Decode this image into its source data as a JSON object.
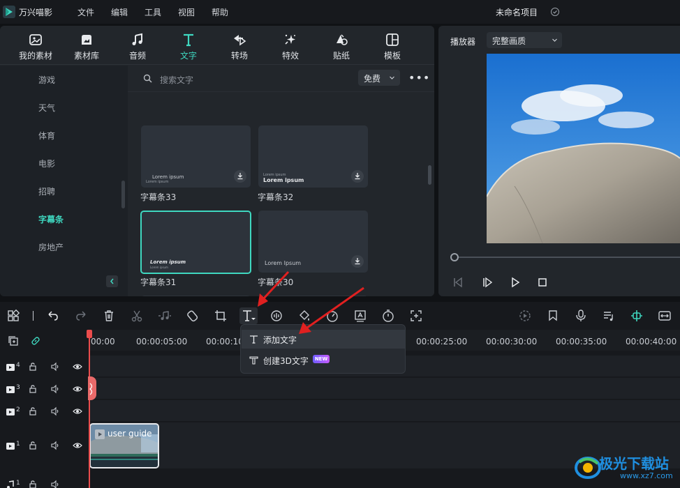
{
  "app": {
    "name": "万兴喵影",
    "project_name": "未命名项目"
  },
  "menu": [
    "文件",
    "编辑",
    "工具",
    "视图",
    "帮助"
  ],
  "tabs": [
    {
      "label": "我的素材",
      "icon": "my-media-icon"
    },
    {
      "label": "素材库",
      "icon": "stock-library-icon"
    },
    {
      "label": "音频",
      "icon": "music-note-icon"
    },
    {
      "label": "文字",
      "icon": "text-t-icon",
      "active": true
    },
    {
      "label": "转场",
      "icon": "transition-icon"
    },
    {
      "label": "特效",
      "icon": "effects-sparkle-icon"
    },
    {
      "label": "贴纸",
      "icon": "sticker-icon"
    },
    {
      "label": "模板",
      "icon": "template-grid-icon"
    }
  ],
  "categories": [
    "游戏",
    "天气",
    "体育",
    "电影",
    "招聘",
    "字幕条",
    "房地产"
  ],
  "active_category": "字幕条",
  "search": {
    "placeholder": "搜索文字",
    "filter": "免费",
    "more": "•••"
  },
  "cards": [
    {
      "label": "字幕条33",
      "line1": "Lorem ipsum",
      "line2": "Lorem ipsum"
    },
    {
      "label": "字幕条32",
      "line1": "Lorem ipsum",
      "line2": "Lorem ipsum"
    },
    {
      "label": "字幕条31",
      "line1": "Lorem ipsum",
      "line2": "Lorem ipsum"
    },
    {
      "label": "字幕条30",
      "line1": "Lorem Ipsum",
      "line2": ""
    }
  ],
  "player": {
    "label": "播放器",
    "quality": "完整画质"
  },
  "ruler_ticks": [
    "00:00",
    "00:00:05:00",
    "00:00:10",
    "00:00:25:00",
    "00:00:30:00",
    "00:00:35:00",
    "00:00:40:00"
  ],
  "tracks": [
    "4",
    "3",
    "2",
    "1",
    "1"
  ],
  "clip": {
    "title": "user guide"
  },
  "dropdown": {
    "add_text": "添加文字",
    "create_3d": "创建3D文字",
    "badge": "NEW"
  },
  "watermark": {
    "name": "极光下载站",
    "url": "www.xz7.com"
  },
  "colors": {
    "accent": "#3fd8c0",
    "playhead": "#ea4c4c",
    "arrow": "#e02020"
  }
}
